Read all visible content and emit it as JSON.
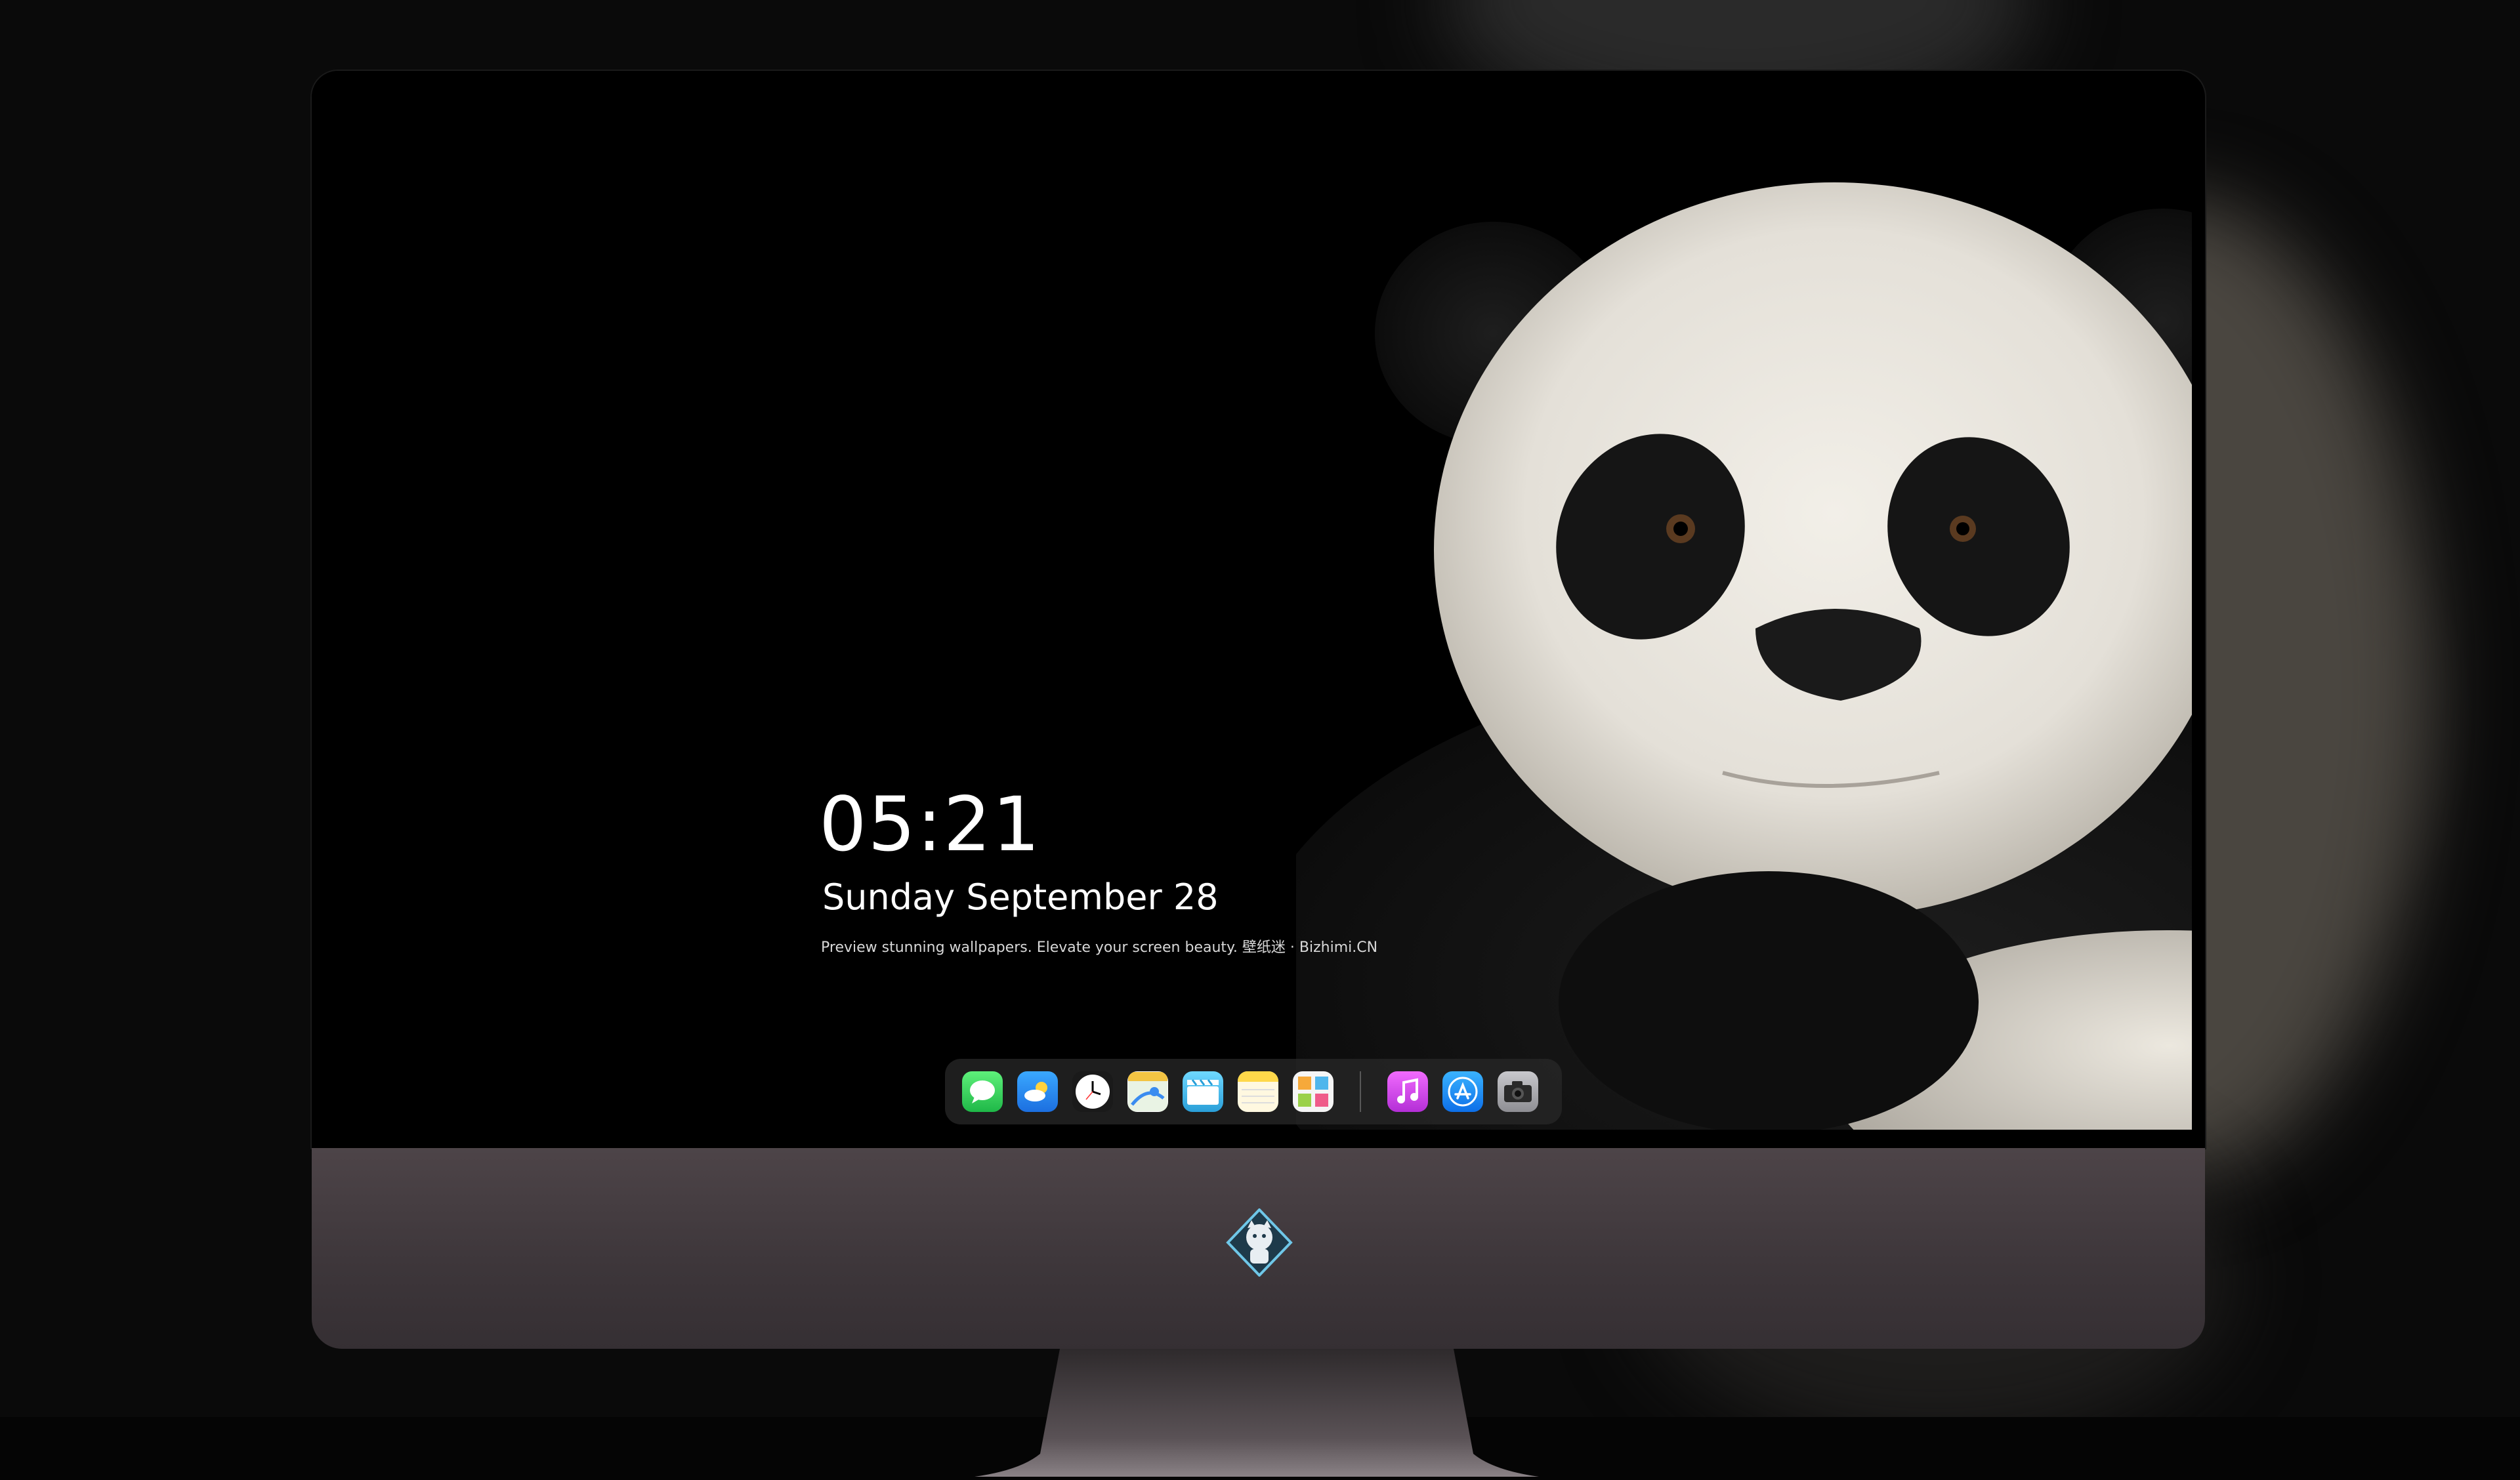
{
  "lockscreen": {
    "time": "05:21",
    "date": "Sunday September  28",
    "tagline": "Preview stunning wallpapers. Elevate your screen beauty. 壁纸迷 · Bizhimi.CN"
  },
  "dock": {
    "apps": [
      {
        "icon": "messages-icon",
        "color": "#2fd158"
      },
      {
        "icon": "weather-icon",
        "color": "#2f8df5"
      },
      {
        "icon": "clock-icon",
        "color": "#ffffff"
      },
      {
        "icon": "maps-icon",
        "color": "#f3c443"
      },
      {
        "icon": "clips-icon",
        "color": "#4fc3f7"
      },
      {
        "icon": "notes-icon",
        "color": "#ffd84a"
      },
      {
        "icon": "photos-icon",
        "color": "#e9e9e9"
      }
    ],
    "apps_right": [
      {
        "icon": "music-icon",
        "color": "#e43ee6"
      },
      {
        "icon": "app-store-icon",
        "color": "#1b8cf5"
      },
      {
        "icon": "camera-icon",
        "color": "#8e8e93"
      }
    ]
  },
  "monitor": {
    "chin_logo": "bizhimi-logo",
    "body_color": "#3f383c"
  }
}
